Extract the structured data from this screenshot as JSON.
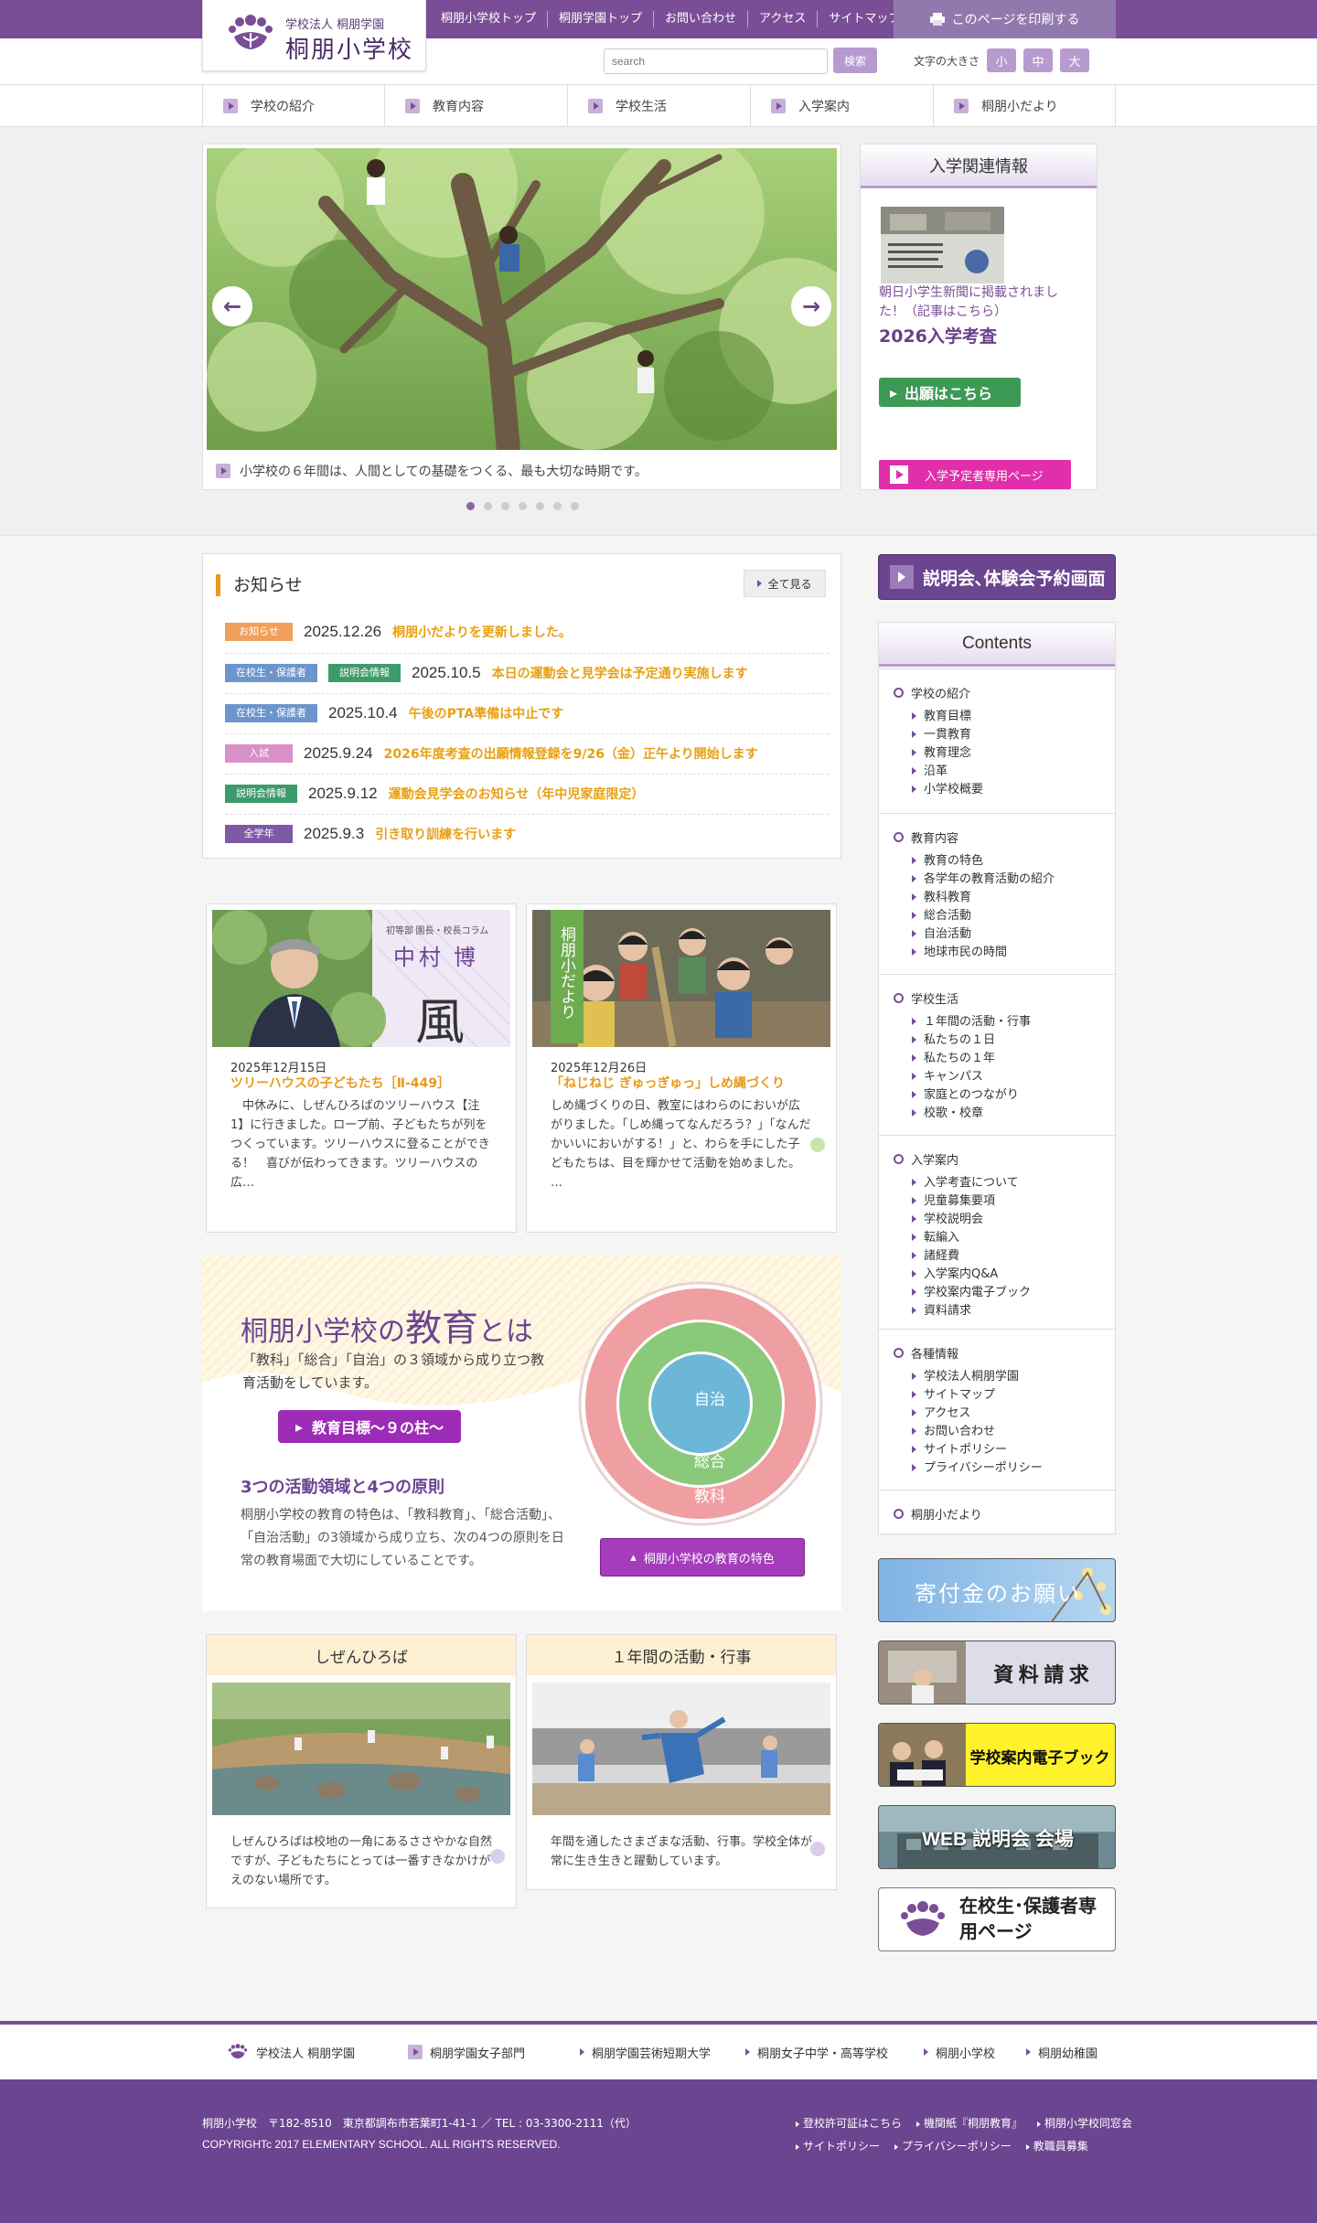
{
  "header": {
    "logo_small": "学校法人 桐朋学園",
    "logo_big": "桐朋小学校",
    "top_links": [
      "桐朋小学校トップ",
      "桐朋学園トップ",
      "お問い合わせ",
      "アクセス",
      "サイトマップ"
    ],
    "print_label": "このページを印刷する",
    "search_placeholder": "search",
    "search_button": "検索",
    "font_size_label": "文字の大きさ",
    "font_sizes": [
      "小",
      "中",
      "大"
    ]
  },
  "main_nav": [
    "学校の紹介",
    "教育内容",
    "学校生活",
    "入学案内",
    "桐朋小だより"
  ],
  "slider": {
    "caption": "小学校の６年間は、人間としての基礎をつくる、最も大切な時期です。",
    "dot_count": 7,
    "active_dot": 0
  },
  "admission": {
    "title": "入学関連情報",
    "news": "朝日小学生新聞に掲載されました！（記事はこちら）",
    "year_title": "2026入学考査",
    "apply": "出願はこちら",
    "preentry": "入学予定者専用ページ"
  },
  "news": {
    "title": "お知らせ",
    "see_all": "全て見る",
    "items": [
      {
        "tags": [
          {
            "label": "お知らせ",
            "color": "#f0a05a"
          }
        ],
        "date": "2025.12.26",
        "text": "桐朋小だよりを更新しました。"
      },
      {
        "tags": [
          {
            "label": "在校生・保護者",
            "color": "#6c95cc"
          },
          {
            "label": "説明会情報",
            "color": "#3d9a6a"
          }
        ],
        "date": "2025.10.5",
        "text": "本日の運動会と見学会は予定通り実施します"
      },
      {
        "tags": [
          {
            "label": "在校生・保護者",
            "color": "#6c95cc"
          }
        ],
        "date": "2025.10.4",
        "text": "午後のPTA準備は中止です"
      },
      {
        "tags": [
          {
            "label": "入試",
            "color": "#d98fc8"
          }
        ],
        "date": "2025.9.24",
        "text": "2026年度考査の出願情報登録を9/26（金）正午より開始します"
      },
      {
        "tags": [
          {
            "label": "説明会情報",
            "color": "#3d9a6a"
          }
        ],
        "date": "2025.9.12",
        "text": "運動会見学会のお知らせ（年中児家庭限定）"
      },
      {
        "tags": [
          {
            "label": "全学年",
            "color": "#7e5aa6"
          }
        ],
        "date": "2025.9.3",
        "text": "引き取り訓練を行います"
      }
    ]
  },
  "columns": [
    {
      "img_sub": "初等部 園長・校長コラム",
      "img_name": "中村 博",
      "img_kanji": "風",
      "date": "2025年12月15日",
      "head": "ツリーハウスの子どもたち［Ⅱ-449］",
      "body": "　中休みに、しぜんひろばのツリーハウス【注1】に行きました。ロープ前、子どもたちが列をつくっています。ツリーハウスに登ることができる！　喜びが伝わってきます。ツリーハウスの広…"
    },
    {
      "img_flag": "桐朋小だより",
      "date": "2025年12月26日",
      "head": "「ねじねじ ぎゅっぎゅっ」しめ縄づくり",
      "body": "しめ縄づくりの日、教室にはわらのにおいが広がりました。「しめ縄ってなんだろう？」「なんだかいいにおいがする！」と、わらを手にした子どもたちは、目を輝かせて活動を始めました。 …"
    }
  ],
  "education": {
    "title_a": "桐朋小学校の",
    "title_b": "教育",
    "title_c": "とは",
    "lead": "「教科」「総合」「自治」の３領域から成り立つ教育活動をしています。",
    "goals": "教育目標～９の柱～",
    "sub": "3つの活動領域と4つの原則",
    "desc": "桐朋小学校の教育の特色は、「教科教育」、「総合活動」、「自治活動」の3領域から成り立ち、次の4つの原則を日常の教育場面で大切にしていることです。",
    "ring_inner": "自治",
    "ring_middle": "総合",
    "ring_outer": "教科",
    "feature_btn": "桐朋小学校の教育の特色"
  },
  "bottom_cards": [
    {
      "title": "しぜんひろば",
      "body": "しぜんひろばは校地の一角にあるささやかな自然ですが、子どもたちにとっては一番すきなかけがえのない場所です。"
    },
    {
      "title": "１年間の活動・行事",
      "body": "年間を通したさまざまな活動、行事。学校全体が常に生き生きと躍動しています。"
    }
  ],
  "sidebar": {
    "reservation": "説明会､体験会予約画面",
    "contents_title": "Contents",
    "groups": [
      {
        "title": "学校の紹介",
        "links": [
          "教育目標",
          "一貫教育",
          "教育理念",
          "沿革",
          "小学校概要"
        ]
      },
      {
        "title": "教育内容",
        "links": [
          "教育の特色",
          "各学年の教育活動の紹介",
          "教科教育",
          "総合活動",
          "自治活動",
          "地球市民の時間"
        ]
      },
      {
        "title": "学校生活",
        "links": [
          "１年間の活動・行事",
          "私たちの１日",
          "私たちの１年",
          "キャンパス",
          "家庭とのつながり",
          "校歌・校章"
        ]
      },
      {
        "title": "入学案内",
        "links": [
          "入学考査について",
          "児童募集要項",
          "学校説明会",
          "転編入",
          "諸経費",
          "入学案内Q&A",
          "学校案内電子ブック",
          "資料請求"
        ]
      },
      {
        "title": "各種情報",
        "links": [
          "学校法人桐朋学園",
          "サイトマップ",
          "アクセス",
          "お問い合わせ",
          "サイトポリシー",
          "プライバシーポリシー"
        ]
      },
      {
        "title": "桐朋小だより",
        "links": []
      }
    ],
    "banners": [
      "寄付金のお願い",
      "資 料 請 求",
      "学校案内電子ブック",
      "WEB 説明会 会場",
      "在校生･保護者専用ページ"
    ]
  },
  "footer_nav": [
    "学校法人 桐朋学園",
    "桐朋学園女子部門",
    "桐朋学園芸術短期大学",
    "桐朋女子中学・高等学校",
    "桐朋小学校",
    "桐朋幼稚園"
  ],
  "footer": {
    "address": "桐朋小学校　〒182-8510　東京都調布市若葉町1-41-1 ／ TEL : 03-3300-2111（代）",
    "copyright": "COPYRIGHTc 2017 ELEMENTARY SCHOOL. ALL RIGHTS RESERVED.",
    "links_row1": [
      "登校許可証はこちら",
      "機関紙『桐朋教育』",
      "桐朋小学校同窓会"
    ],
    "links_row2": [
      "サイトポリシー",
      "プライバシーポリシー",
      "教職員募集"
    ]
  }
}
